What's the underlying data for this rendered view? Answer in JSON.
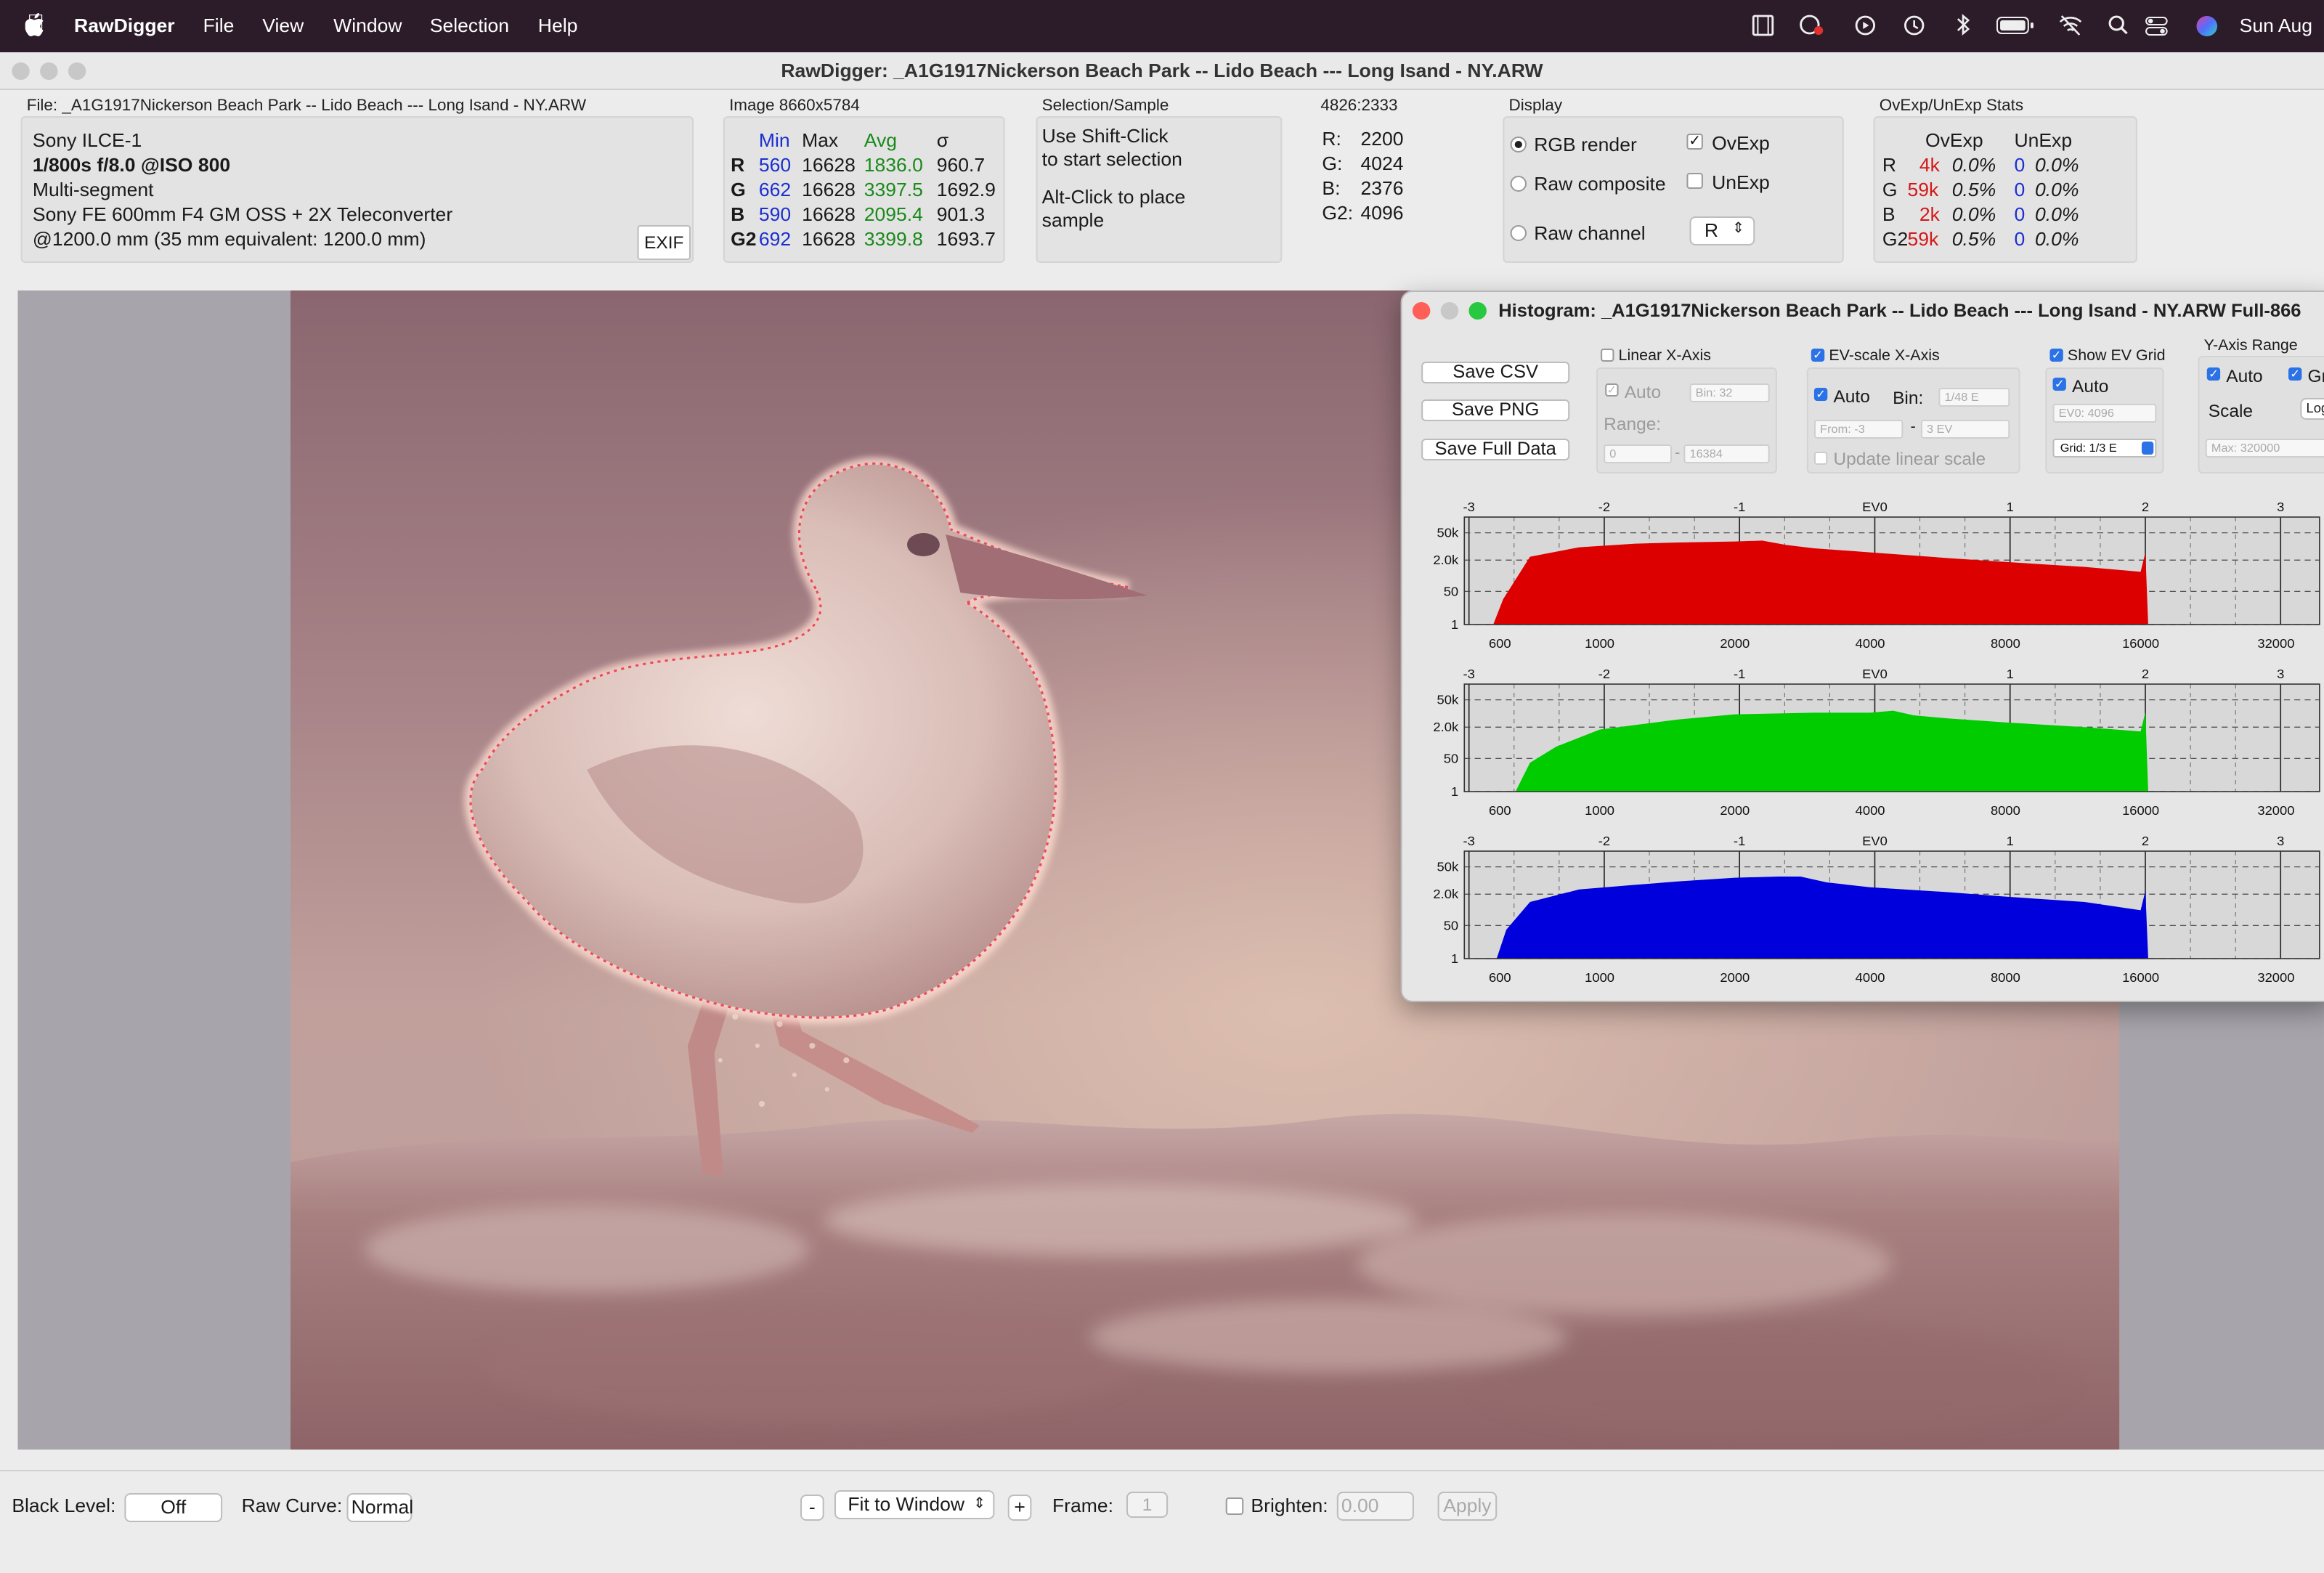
{
  "menubar": {
    "app_name": "RawDigger",
    "menus": [
      "File",
      "View",
      "Window",
      "Selection",
      "Help"
    ],
    "clock": "Sun Aug",
    "status_icons": [
      "film-strip-icon",
      "color-wheel-icon",
      "play-circle-icon",
      "clock-history-icon",
      "bluetooth-icon",
      "battery-icon",
      "wifi-off-icon",
      "search-icon",
      "control-center-icon",
      "siri-icon"
    ]
  },
  "window": {
    "title": "RawDigger: _A1G1917Nickerson Beach Park -- Lido Beach --- Long Isand - NY.ARW"
  },
  "file_panel": {
    "label": "File: _A1G1917Nickerson Beach Park -- Lido Beach --- Long Isand - NY.ARW",
    "camera": "Sony ILCE-1",
    "exposure": "1/800s f/8.0 @ISO 800",
    "metering": "Multi-segment",
    "lens": "Sony FE 600mm F4 GM OSS + 2X Teleconverter",
    "focal": "@1200.0 mm (35 mm equivalent: 1200.0 mm)",
    "exif_button": "EXIF"
  },
  "image_stats": {
    "label": "Image 8660x5784",
    "headers": [
      "Min",
      "Max",
      "Avg",
      "σ"
    ],
    "rows": [
      {
        "ch": "R",
        "min": "560",
        "max": "16628",
        "avg": "1836.0",
        "sigma": "960.7"
      },
      {
        "ch": "G",
        "min": "662",
        "max": "16628",
        "avg": "3397.5",
        "sigma": "1692.9"
      },
      {
        "ch": "B",
        "min": "590",
        "max": "16628",
        "avg": "2095.4",
        "sigma": "901.3"
      },
      {
        "ch": "G2",
        "min": "692",
        "max": "16628",
        "avg": "3399.8",
        "sigma": "1693.7"
      }
    ]
  },
  "selection": {
    "label": "Selection/Sample",
    "line1": "Use Shift-Click",
    "line2": "to start selection",
    "line3": "Alt-Click to place",
    "line4": "sample"
  },
  "pixel": {
    "label": "4826:2333",
    "rows": [
      {
        "ch": "R:",
        "val": "2200"
      },
      {
        "ch": "G:",
        "val": "4024"
      },
      {
        "ch": "B:",
        "val": "2376"
      },
      {
        "ch": "G2:",
        "val": "4096"
      }
    ]
  },
  "display": {
    "label": "Display",
    "rgb_render": "RGB render",
    "raw_composite": "Raw composite",
    "raw_channel": "Raw channel",
    "ovexp": "OvExp",
    "unexp": "UnExp",
    "channel_value": "R"
  },
  "ovexp_stats": {
    "label": "OvExp/UnExp Stats",
    "headers": [
      "OvExp",
      "UnExp"
    ],
    "rows": [
      {
        "ch": "R",
        "ov": "4k",
        "ovp": "0.0%",
        "un": "0",
        "unp": "0.0%"
      },
      {
        "ch": "G",
        "ov": "59k",
        "ovp": "0.5%",
        "un": "0",
        "unp": "0.0%"
      },
      {
        "ch": "B",
        "ov": "2k",
        "ovp": "0.0%",
        "un": "0",
        "unp": "0.0%"
      },
      {
        "ch": "G2",
        "ov": "59k",
        "ovp": "0.5%",
        "un": "0",
        "unp": "0.0%"
      }
    ]
  },
  "histogram": {
    "title": "Histogram: _A1G1917Nickerson Beach Park -- Lido Beach --- Long Isand - NY.ARW Full-866",
    "save_csv": "Save CSV",
    "save_png": "Save PNG",
    "save_full": "Save Full Data",
    "linear_label": "Linear X-Axis",
    "linear_auto": "Auto",
    "linear_bin": "Bin: 32",
    "range_label": "Range:",
    "range_from": "0",
    "range_to": "16384",
    "ev_label": "EV-scale X-Axis",
    "ev_auto": "Auto",
    "ev_bin_label": "Bin:",
    "ev_bin": "1/48 E",
    "ev_from": "From: -3",
    "ev_to": "3 EV",
    "update_linear": "Update linear scale",
    "show_grid": "Show EV Grid",
    "grid_auto": "Auto",
    "ev0": "EV0: 4096",
    "grid_select": "Grid: 1/3 E",
    "yaxis_label": "Y-Axis Range",
    "y_auto": "Auto",
    "y_gr": "Gr",
    "scale_label": "Scale",
    "scale_value": "Log",
    "y_max": "Max: 320000",
    "ev_ticks": [
      "-3",
      "-2",
      "-1",
      "EV0",
      "1",
      "2",
      "3"
    ],
    "y_ticks": [
      "50k",
      "2.0k",
      "50",
      "1"
    ],
    "x_ticks": [
      "600",
      "1000",
      "2000",
      "4000",
      "8000",
      "16000",
      "32000"
    ]
  },
  "chart_data": [
    {
      "type": "area",
      "title": "",
      "series": [
        {
          "name": "R",
          "color": "#dd0000",
          "x": [
            580,
            610,
            700,
            900,
            1200,
            1500,
            2000,
            2300,
            2600,
            3000,
            4000,
            6000,
            8000,
            12000,
            16000,
            16384,
            16628
          ],
          "y": [
            1,
            20,
            3000,
            9000,
            14000,
            16000,
            18000,
            20000,
            12000,
            8000,
            5000,
            2500,
            1600,
            900,
            500,
            5000,
            1
          ]
        }
      ],
      "xlim": [
        500,
        40000
      ],
      "ylim": [
        1,
        320000
      ],
      "xscale": "log",
      "yscale": "log",
      "grid": true
    },
    {
      "type": "area",
      "title": "",
      "series": [
        {
          "name": "G",
          "color": "#00cc00",
          "x": [
            650,
            700,
            800,
            1000,
            1500,
            2000,
            3000,
            4000,
            4500,
            5000,
            6000,
            8000,
            12000,
            16000,
            16384,
            16628
          ],
          "y": [
            1,
            30,
            200,
            1500,
            5000,
            9000,
            11000,
            11000,
            14000,
            8000,
            5500,
            3500,
            2000,
            1200,
            12000,
            1
          ]
        }
      ],
      "xlim": [
        500,
        40000
      ],
      "ylim": [
        1,
        320000
      ],
      "xscale": "log",
      "yscale": "log",
      "grid": true
    },
    {
      "type": "area",
      "title": "",
      "series": [
        {
          "name": "B",
          "color": "#0000dd",
          "x": [
            590,
            620,
            700,
            900,
            1200,
            1500,
            2000,
            2500,
            2800,
            3200,
            4000,
            6000,
            8000,
            12000,
            16000,
            16384,
            16628
          ],
          "y": [
            1,
            30,
            800,
            3500,
            6000,
            9000,
            14000,
            16000,
            16000,
            8000,
            4500,
            2500,
            1500,
            800,
            300,
            3000,
            1
          ]
        }
      ],
      "xlim": [
        500,
        40000
      ],
      "ylim": [
        1,
        320000
      ],
      "xscale": "log",
      "yscale": "log",
      "grid": true
    }
  ],
  "bottombar": {
    "black_level_label": "Black Level:",
    "black_level_value": "Off",
    "raw_curve_label": "Raw Curve:",
    "raw_curve_value": "Normal",
    "minus": "-",
    "fit": "Fit to Window",
    "plus": "+",
    "frame_label": "Frame:",
    "frame_value": "1",
    "brighten_label": "Brighten:",
    "brighten_value": "0.00",
    "apply": "Apply"
  },
  "colors": {
    "red": "#dd0000",
    "green": "#00cc00",
    "blue": "#0000dd",
    "accent": "#2a72e6"
  }
}
